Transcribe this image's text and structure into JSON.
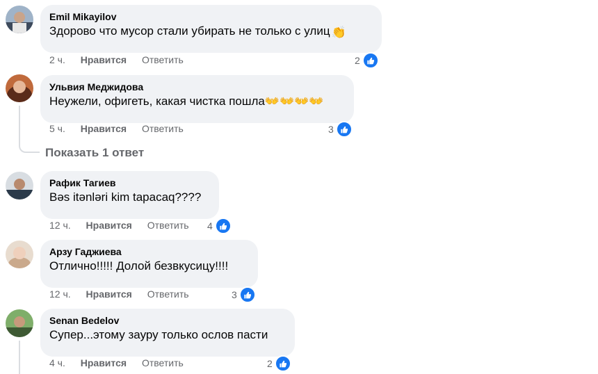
{
  "comments": [
    {
      "author": "Emil Mikayilov",
      "text": "Здорово что мусор стали убирать не только с улиц",
      "emoji": "👏",
      "time": "2 ч.",
      "like": "Нравится",
      "reply": "Ответить",
      "reactions": "2"
    },
    {
      "author": "Ульвия Меджидова",
      "text": "Неужели, офигеть, какая чистка пошла",
      "emoji": "👐👐👐👐",
      "time": "5 ч.",
      "like": "Нравится",
      "reply": "Ответить",
      "reactions": "3"
    },
    {
      "author": "Рафик Тагиев",
      "text": "Bəs itənləri kim tapacaq????",
      "time": "12 ч.",
      "like": "Нравится",
      "reply": "Ответить",
      "reactions": "4"
    },
    {
      "author": "Арзу Гаджиева",
      "text": "Отлично!!!!! Долой безвкусицу!!!!",
      "time": "12 ч.",
      "like": "Нравится",
      "reply": "Ответить",
      "reactions": "3"
    },
    {
      "author": "Senan Bedelov",
      "text": "Супер...этому зауру только ослов пасти",
      "time": "4 ч.",
      "like": "Нравится",
      "reply": "Ответить",
      "reactions": "2"
    }
  ],
  "show_replies_label": "Показать 1 ответ",
  "colors": {
    "accent": "#1877f2",
    "bubble": "#f0f2f5",
    "muted": "#65676b"
  },
  "icons": {
    "reaction": "like-icon",
    "avatar": "avatar"
  }
}
